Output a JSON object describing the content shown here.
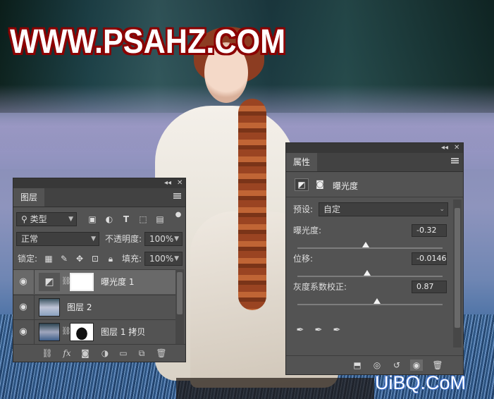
{
  "watermarks": {
    "top": "WWW.PSAHZ.COM",
    "bottom": "UiBQ.CoM"
  },
  "layers_panel": {
    "title": "图层",
    "filter": {
      "label": "类型"
    },
    "blend_mode": "正常",
    "opacity_label": "不透明度:",
    "opacity_value": "100%",
    "lock_label": "锁定:",
    "fill_label": "填充:",
    "fill_value": "100%",
    "layers": [
      {
        "name": "曝光度 1",
        "type": "adjustment",
        "visible": true,
        "selected": true
      },
      {
        "name": "图层 2",
        "type": "pixel",
        "visible": true,
        "selected": false
      },
      {
        "name": "图层 1 拷贝",
        "type": "pixel-with-mask",
        "visible": true,
        "selected": false
      }
    ],
    "bottom_icons": [
      "link-icon",
      "fx-icon",
      "add-mask-icon",
      "adjustment-icon",
      "folder-icon",
      "new-layer-icon",
      "trash-icon"
    ],
    "bottom_fx_label": "fx"
  },
  "properties_panel": {
    "title": "属性",
    "adjustment_name": "曝光度",
    "preset_label": "预设:",
    "preset_value": "自定",
    "controls": [
      {
        "label": "曝光度:",
        "value": "-0.32"
      },
      {
        "label": "位移:",
        "value": "-0.0146"
      },
      {
        "label": "灰度系数校正:",
        "value": "0.87"
      }
    ],
    "bottom_icons": [
      "clip-to-layer-icon",
      "view-previous-icon",
      "reset-icon",
      "visibility-eye-icon",
      "trash-icon"
    ]
  }
}
